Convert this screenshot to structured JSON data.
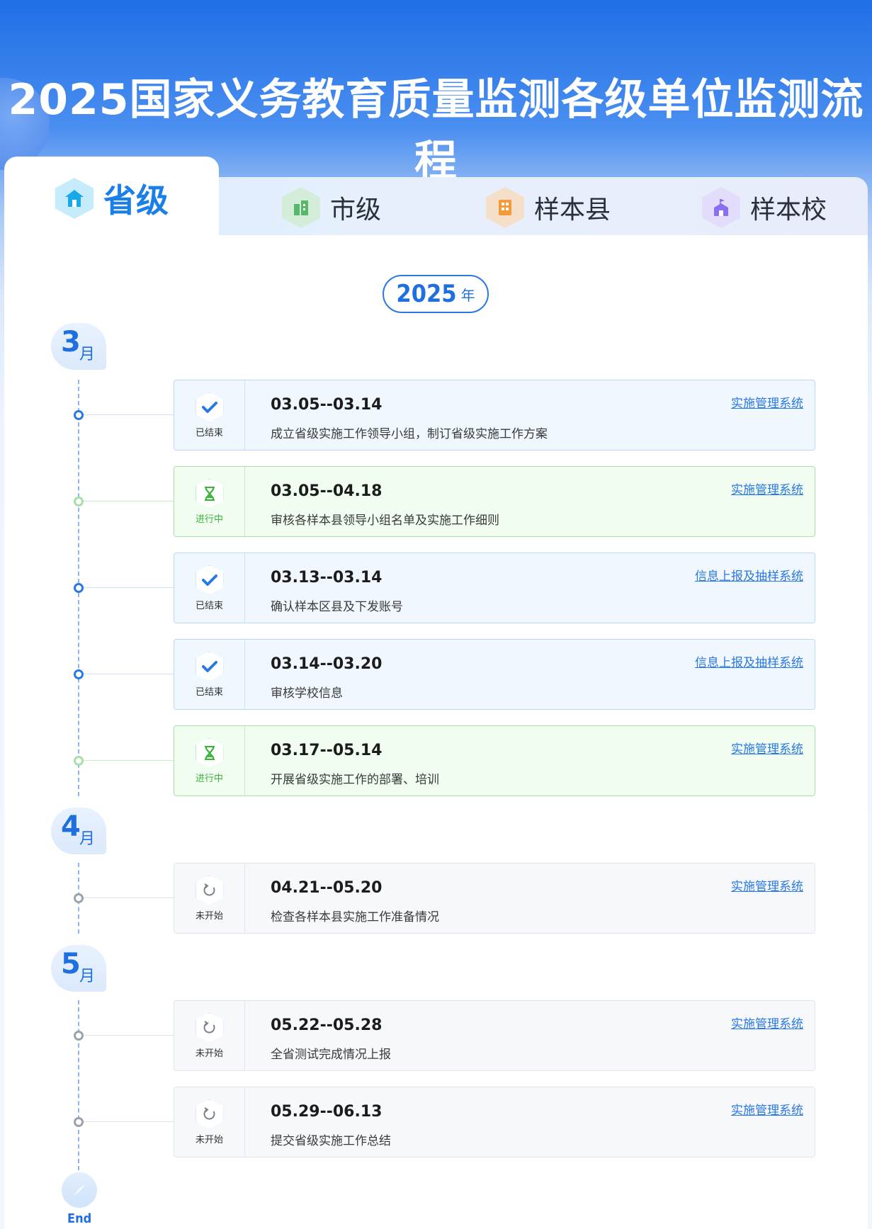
{
  "title": "2025国家义务教育质量监测各级单位监测流程",
  "tabs": [
    {
      "label": "省级",
      "icon": "province-building-icon",
      "color": "#1aa9e8"
    },
    {
      "label": "市级",
      "icon": "city-building-icon",
      "color": "#55b86b"
    },
    {
      "label": "样本县",
      "icon": "county-building-icon",
      "color": "#f29b38"
    },
    {
      "label": "样本校",
      "icon": "school-icon",
      "color": "#8a6ff0"
    }
  ],
  "year": {
    "num": "2025",
    "unit": "年"
  },
  "months": [
    {
      "num": "3",
      "unit": "月"
    },
    {
      "num": "4",
      "unit": "月"
    },
    {
      "num": "5",
      "unit": "月"
    }
  ],
  "tasks": [
    {
      "status": "已结束",
      "date": "03.05--03.14",
      "desc": "成立省级实施工作领导小组，制订省级实施工作方案",
      "link": "实施管理系统"
    },
    {
      "status": "进行中",
      "date": "03.05--04.18",
      "desc": "审核各样本县领导小组名单及实施工作细则",
      "link": "实施管理系统"
    },
    {
      "status": "已结束",
      "date": "03.13--03.14",
      "desc": "确认样本区县及下发账号",
      "link": "信息上报及抽样系统"
    },
    {
      "status": "已结束",
      "date": "03.14--03.20",
      "desc": "审核学校信息",
      "link": "信息上报及抽样系统"
    },
    {
      "status": "进行中",
      "date": "03.17--05.14",
      "desc": "开展省级实施工作的部署、培训",
      "link": "实施管理系统"
    },
    {
      "status": "未开始",
      "date": "04.21--05.20",
      "desc": "检查各样本县实施工作准备情况",
      "link": "实施管理系统"
    },
    {
      "status": "未开始",
      "date": "05.22--05.28",
      "desc": "全省测试完成情况上报",
      "link": "实施管理系统"
    },
    {
      "status": "未开始",
      "date": "05.29--06.13",
      "desc": "提交省级实施工作总结",
      "link": "实施管理系统"
    }
  ],
  "end_label": "End",
  "colors": {
    "accent": "#2a78e4",
    "done": "#2a78e4",
    "in_progress": "#3cb43c",
    "not_started": "#9aa3ad"
  }
}
